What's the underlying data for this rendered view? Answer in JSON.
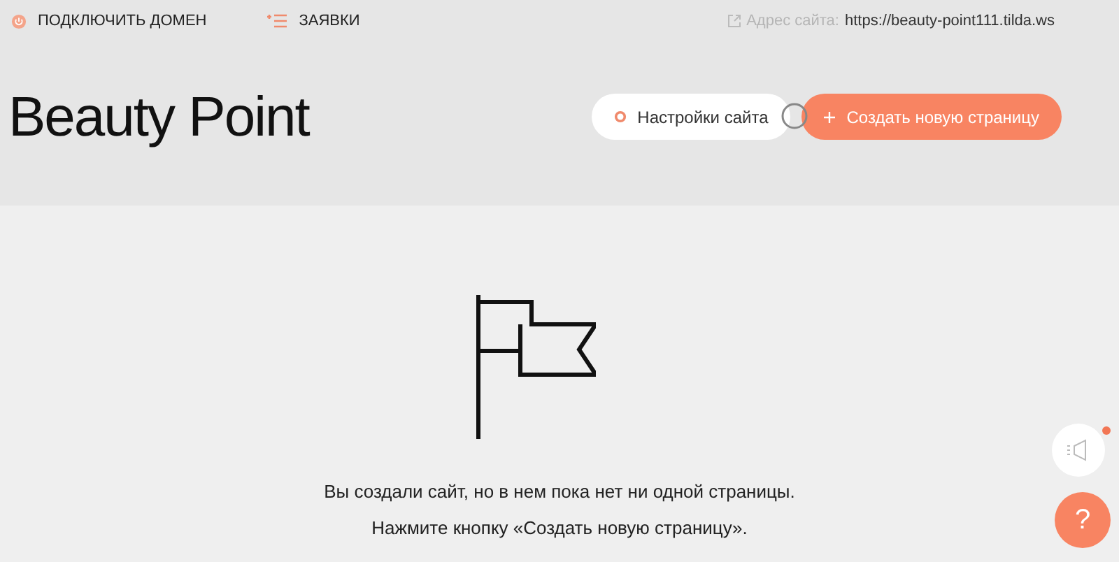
{
  "top_bar": {
    "links": [
      {
        "label": "ПОДКЛЮЧИТЬ ДОМЕН",
        "kind": "power"
      },
      {
        "label": "ЗАЯВКИ",
        "kind": "list"
      }
    ],
    "site_address": {
      "label": "Адрес сайта:",
      "url": "https://beauty-point111.tilda.ws"
    }
  },
  "header": {
    "title": "Beauty Point",
    "settings_button": "Настройки сайта",
    "create_button": "Создать новую страницу"
  },
  "empty_state": {
    "lines": [
      "Вы создали сайт, но в нем пока нет ни одной страницы.",
      "Нажмите кнопку «Создать новую страницу»."
    ]
  },
  "floating": {
    "notifications_unread": true,
    "help": "?"
  }
}
